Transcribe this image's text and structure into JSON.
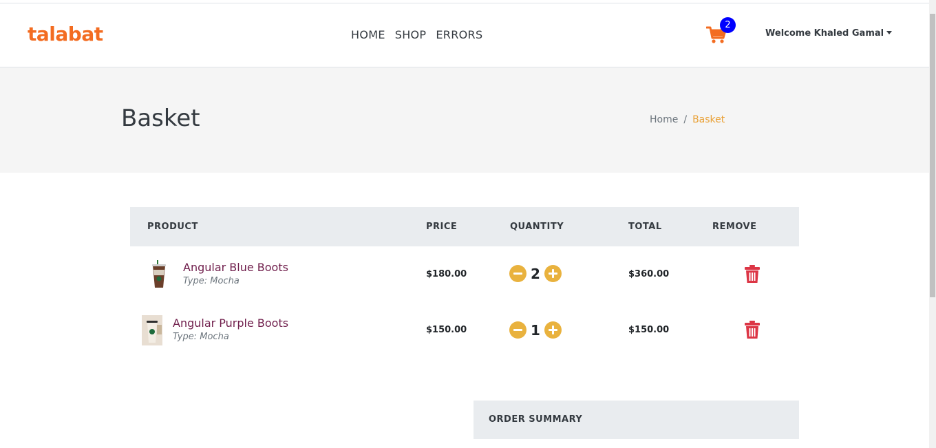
{
  "brand": {
    "logo": "talabat",
    "accent": "#f36c21"
  },
  "nav": {
    "items": [
      "HOME",
      "SHOP",
      "ERRORS"
    ]
  },
  "cart": {
    "icon": "shopping-cart-icon",
    "count": "2"
  },
  "user": {
    "welcome": "Welcome Khaled Gamal"
  },
  "banner": {
    "title": "Basket",
    "breadcrumb": [
      "Home",
      "Basket"
    ]
  },
  "table": {
    "headers": [
      "PRODUCT",
      "PRICE",
      "QUANTITY",
      "TOTAL",
      "REMOVE"
    ],
    "rows": [
      {
        "name": "Angular Blue Boots",
        "type": "Type: Mocha",
        "price": "$180.00",
        "quantity": "2",
        "total": "$360.00"
      },
      {
        "name": "Angular Purple Boots",
        "type": "Type: Mocha",
        "price": "$150.00",
        "quantity": "1",
        "total": "$150.00"
      }
    ]
  },
  "summary": {
    "title": "ORDER SUMMARY"
  },
  "colors": {
    "quantity_button": "#e9b23e",
    "remove_icon": "#dc3545",
    "product_link": "#6f1d4b",
    "badge": "#0000ff"
  }
}
